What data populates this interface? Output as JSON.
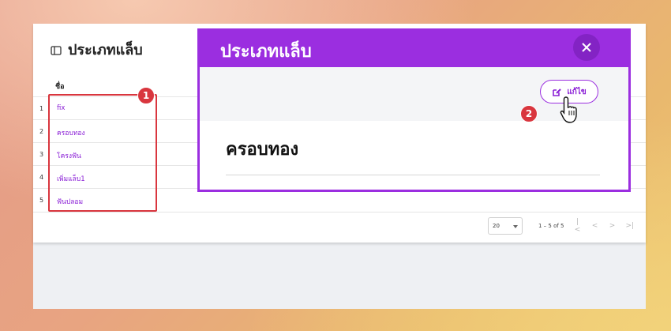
{
  "page": {
    "title": "ประเภทแล็บ",
    "column_header": "ชื่อ",
    "rows": [
      {
        "num": "1",
        "name": "fix"
      },
      {
        "num": "2",
        "name": "ครอบทอง"
      },
      {
        "num": "3",
        "name": "โครงฟัน"
      },
      {
        "num": "4",
        "name": "เพิ่มแล็บ1"
      },
      {
        "num": "5",
        "name": "ฟันปลอม"
      }
    ],
    "pagination": {
      "page_size": "20",
      "range": "1 – 5 of 5"
    }
  },
  "modal": {
    "title": "ประเภทแล็บ",
    "edit_label": "แก้ไข",
    "record_name": "ครอบทอง"
  },
  "annotations": {
    "step1": "1",
    "step2": "2"
  },
  "colors": {
    "accent": "#9b2ee0",
    "link": "#8a1fd6",
    "annotation": "#d9363e"
  }
}
